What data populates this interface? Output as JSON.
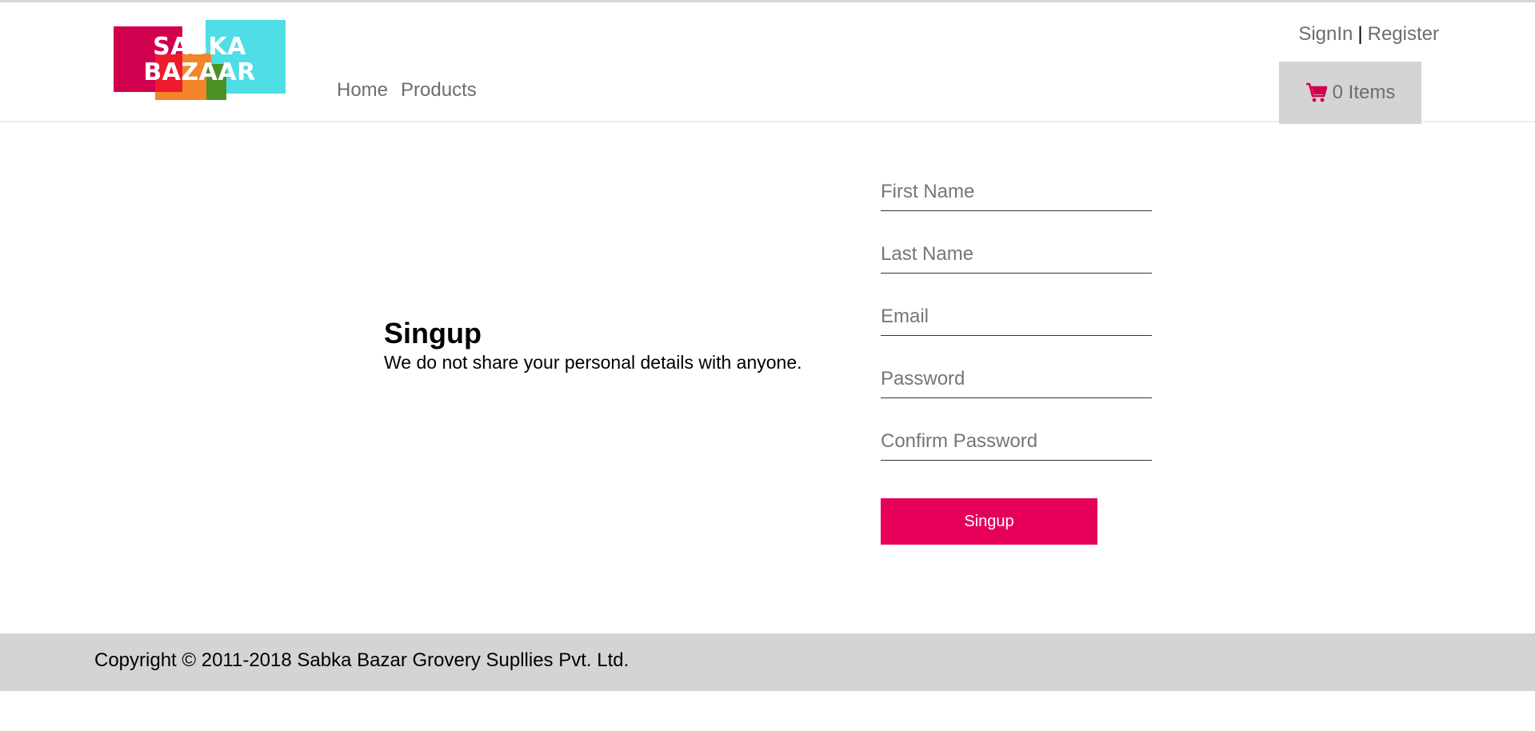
{
  "header": {
    "logo_text_line1": "SABKA",
    "logo_text_line2": "BAZAAR",
    "nav": [
      {
        "label": "Home"
      },
      {
        "label": "Products"
      }
    ],
    "auth": {
      "signin": "SignIn",
      "separator": "|",
      "register": "Register"
    },
    "cart": {
      "label": "0 Items",
      "icon": "shopping-cart-icon",
      "icon_color": "#d1004f"
    }
  },
  "main": {
    "title": "Singup",
    "subtitle": "We do not share your personal details with anyone.",
    "fields": [
      {
        "placeholder": "First Name",
        "value": ""
      },
      {
        "placeholder": "Last Name",
        "value": ""
      },
      {
        "placeholder": "Email",
        "value": ""
      },
      {
        "placeholder": "Password",
        "value": ""
      },
      {
        "placeholder": "Confirm Password",
        "value": ""
      }
    ],
    "submit_label": "Singup"
  },
  "footer": {
    "copyright": "Copyright © 2011-2018 Sabka Bazar Grovery Supllies Pvt. Ltd."
  },
  "colors": {
    "accent": "#e6005a",
    "footer_bg": "#d4d4d4",
    "cart_bg": "#d4d4d4"
  }
}
